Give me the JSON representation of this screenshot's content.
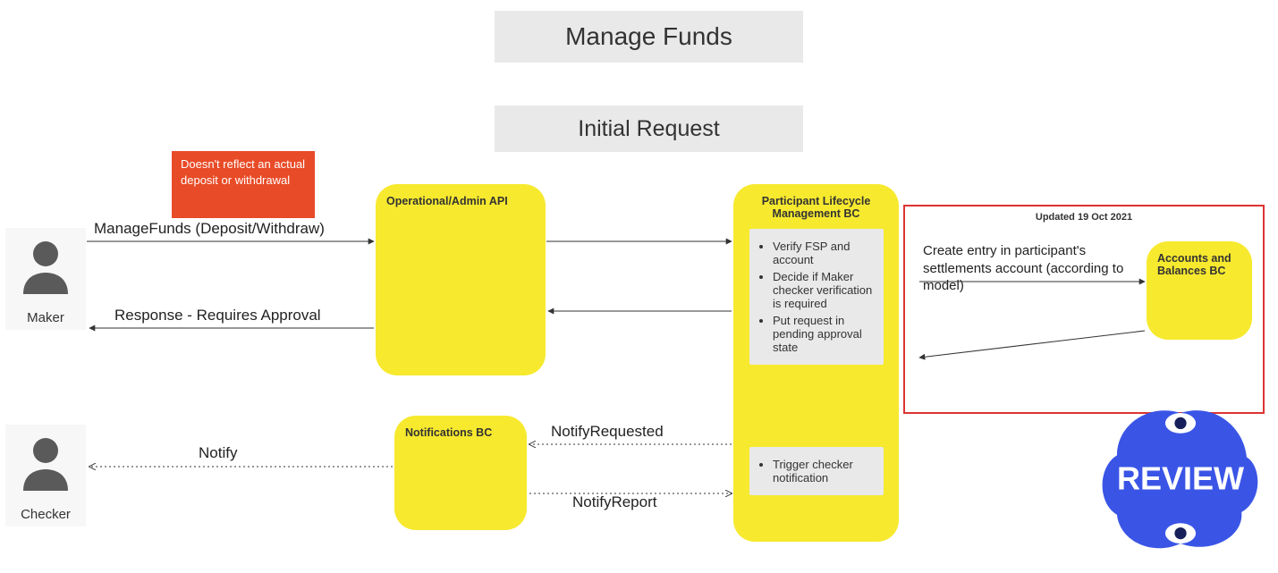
{
  "title": "Manage Funds",
  "subtitle": "Initial Request",
  "warning_note": "Doesn't reflect an actual deposit or withdrawal",
  "actors": {
    "maker": "Maker",
    "checker": "Checker"
  },
  "nodes": {
    "api": "Operational/Admin API",
    "plm": "Participant Lifecycle Management BC",
    "notif": "Notifications BC",
    "acct": "Accounts and Balances BC"
  },
  "plm_steps": {
    "a": "Verify FSP and account",
    "b": "Decide if Maker checker verification is required",
    "c": "Put request in pending approval state"
  },
  "trigger_step": "Trigger checker notification",
  "redframe": {
    "stamp": "Updated 19 Oct 2021",
    "entry": "Create entry in participant's settlements account (according to model)"
  },
  "messages": {
    "m1": "ManageFunds (Deposit/Withdraw)",
    "m2": "Response - Requires Approval",
    "m3": "NotifyRequested",
    "m4": "NotifyReport",
    "m5": "Notify"
  },
  "review_badge": "REVIEW"
}
